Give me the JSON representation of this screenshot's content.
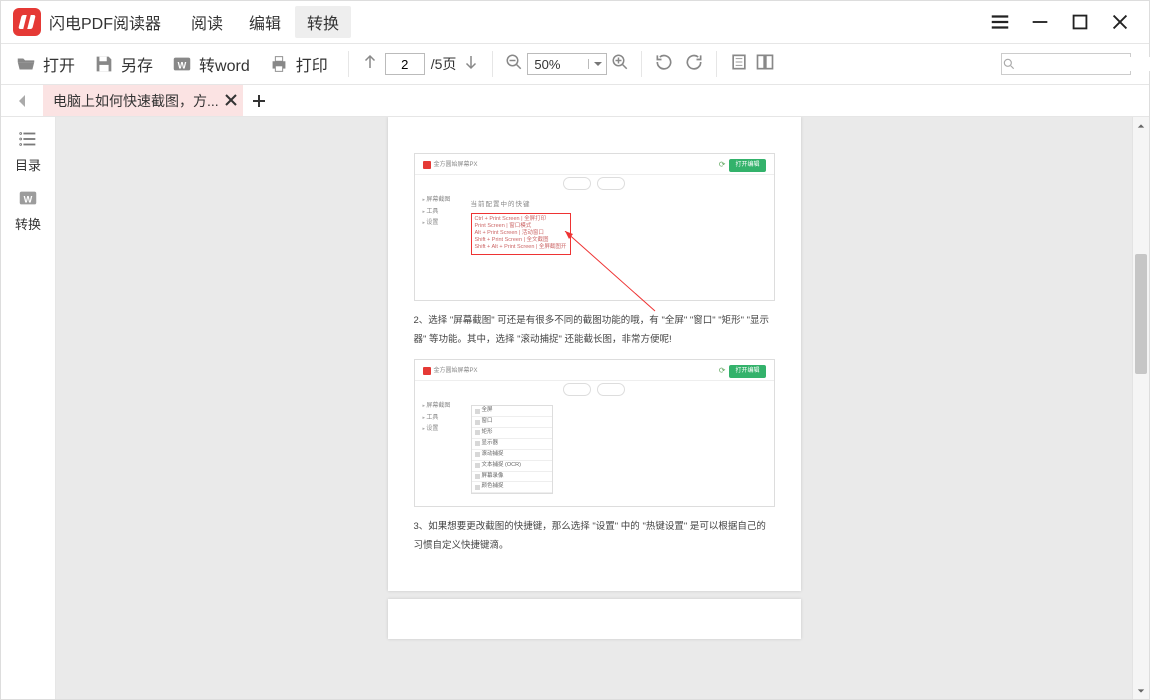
{
  "app": {
    "title": "闪电PDF阅读器"
  },
  "mode_tabs": {
    "read": "阅读",
    "edit": "编辑",
    "convert": "转换",
    "active": "convert"
  },
  "toolbar": {
    "open": "打开",
    "save_as": "另存",
    "to_word": "转word",
    "print": "打印",
    "page_current": "2",
    "page_total": "/5页",
    "zoom_value": "50%"
  },
  "tabs": {
    "doc_title": "电脑上如何快速截图，方..."
  },
  "sidebar": {
    "toc": "目录",
    "convert": "转换"
  },
  "document": {
    "caption2": "2、选择 \"屏幕截图\" 可还是有很多不同的截图功能的哦，有 \"全屏\" \"窗口\" \"矩形\" \"显示器\" 等功能。其中，选择 \"滚动捕捉\" 还能截长图，非常方便呢!",
    "caption3": "3、如果想要更改截图的快捷键，那么选择 \"设置\" 中的 \"热键设置\" 是可以根据自己的习惯自定义快捷键滴。",
    "inner_title1": "当前配置中的快键",
    "inner_btn": "打开编辑",
    "inner_brand": "金方圆始屏幕PX",
    "nav1": "屏幕截图",
    "nav2": "工具",
    "nav3": "设置",
    "rb1": "Ctrl + Print Screen | 全屏打印",
    "rb2": "Print Screen | 窗口模式",
    "rb3": "Alt + Print Screen | 活动窗口",
    "rb4": "Shift + Print Screen | 全文截图",
    "rb5": "Shift + Alt + Print Screen | 全屏截图开",
    "dd1": "全屏",
    "dd2": "窗口",
    "dd3": "矩形",
    "dd4": "显示器",
    "dd5": "滚动捕捉",
    "dd6": "文本捕捉 (OCR)",
    "dd7": "屏幕录像",
    "dd8": "颜色捕捉"
  }
}
